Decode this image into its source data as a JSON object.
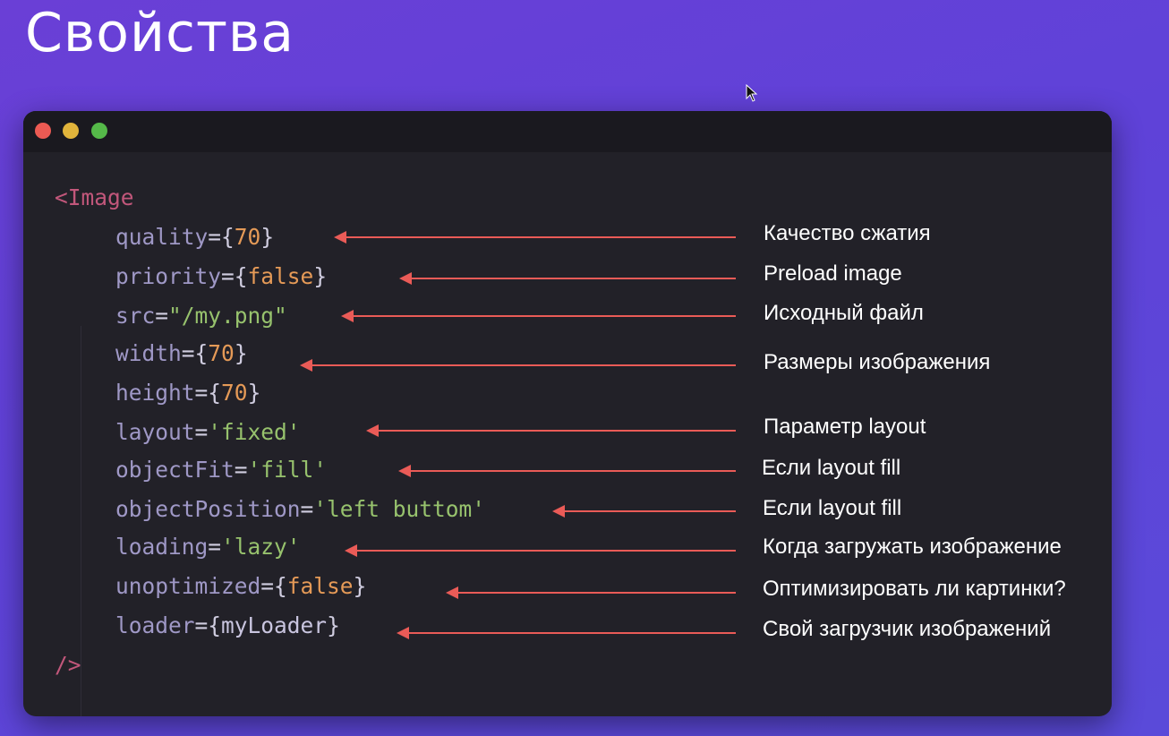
{
  "slide": {
    "title": "Свойства"
  },
  "code": {
    "open": "<Image",
    "close": "/>",
    "props": [
      {
        "name": "quality",
        "eq": "=",
        "open": "{",
        "value": "70",
        "close": "}",
        "kind": "num"
      },
      {
        "name": "priority",
        "eq": "=",
        "open": "{",
        "value": "false",
        "close": "}",
        "kind": "bool"
      },
      {
        "name": "src",
        "eq": "=",
        "open": "",
        "value": "\"/my.png\"",
        "close": "",
        "kind": "str"
      },
      {
        "name": "width",
        "eq": "=",
        "open": "{",
        "value": "70",
        "close": "}",
        "kind": "num"
      },
      {
        "name": "height",
        "eq": "=",
        "open": "{",
        "value": "70",
        "close": "}",
        "kind": "num"
      },
      {
        "name": "layout",
        "eq": "=",
        "open": "",
        "value": "'fixed'",
        "close": "",
        "kind": "str"
      },
      {
        "name": "objectFit",
        "eq": "=",
        "open": "",
        "value": "'fill'",
        "close": "",
        "kind": "str"
      },
      {
        "name": "objectPosition",
        "eq": "=",
        "open": "",
        "value": "'left buttom'",
        "close": "",
        "kind": "str"
      },
      {
        "name": "loading",
        "eq": "=",
        "open": "",
        "value": "'lazy'",
        "close": "",
        "kind": "str"
      },
      {
        "name": "unoptimized",
        "eq": "=",
        "open": "{",
        "value": "false",
        "close": "}",
        "kind": "bool"
      },
      {
        "name": "loader",
        "eq": "=",
        "open": "{",
        "value": "myLoader",
        "close": "}",
        "kind": "ident"
      }
    ]
  },
  "annotations": [
    "Качество сжатия",
    "Preload image",
    "Исходный файл",
    "Размеры изображения",
    "Параметр layout",
    "Если layout fill",
    "Если layout fill",
    "Когда загружать изображение",
    "Оптимизировать ли картинки?",
    "Свой загрузчик изображений"
  ],
  "colors": {
    "background": "#6a3fd6",
    "window": "#222128",
    "arrow": "#ea5b57",
    "dot_red": "#ec5a53",
    "dot_yellow": "#e1b43b",
    "dot_green": "#55b949"
  }
}
